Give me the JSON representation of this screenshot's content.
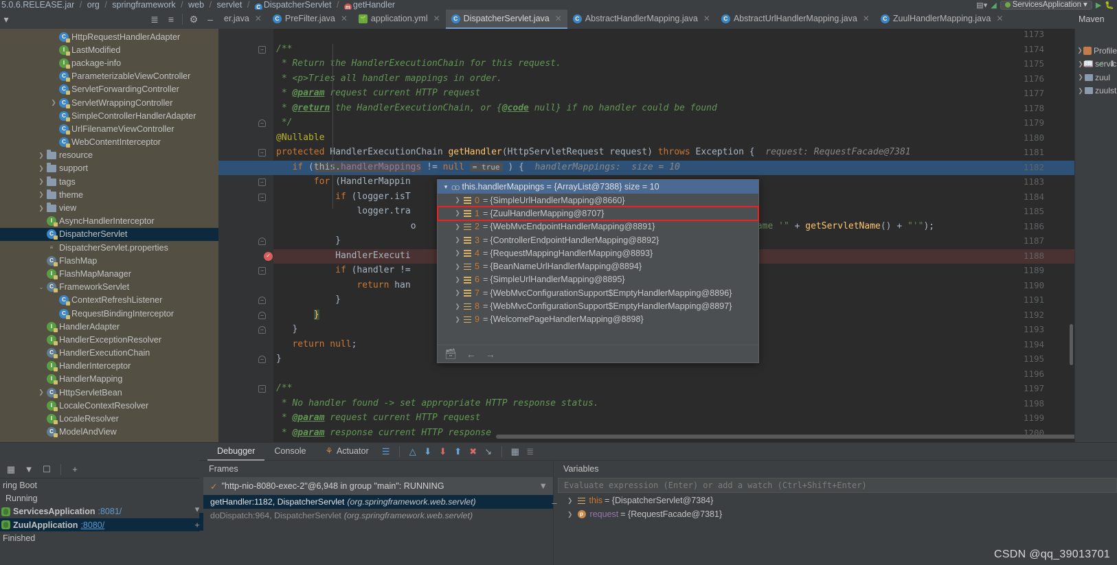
{
  "breadcrumb": {
    "jar": "5.0.6.RELEASE.jar",
    "parts": [
      "org",
      "springframework",
      "web",
      "servlet"
    ],
    "class": "DispatcherServlet",
    "method": "getHandler"
  },
  "run_config": {
    "name": "ServicesApplication"
  },
  "tabs": [
    {
      "label": "er.java",
      "icon": "",
      "active": false,
      "partial": true
    },
    {
      "label": "PreFilter.java",
      "icon": "class-icon",
      "active": false
    },
    {
      "label": "application.yml",
      "icon": "yaml-icon",
      "active": false
    },
    {
      "label": "DispatcherServlet.java",
      "icon": "class-icon",
      "active": true
    },
    {
      "label": "AbstractHandlerMapping.java",
      "icon": "class-icon",
      "active": false
    },
    {
      "label": "AbstractUrlHandlerMapping.java",
      "icon": "class-icon",
      "active": false
    },
    {
      "label": "ZuulHandlerMapping.java",
      "icon": "class-icon",
      "active": false
    }
  ],
  "right_tab": {
    "label": "Maven"
  },
  "tree": [
    {
      "label": "HttpRequestHandlerAdapter",
      "icon": "class-icon",
      "indent": 3,
      "arrow": ""
    },
    {
      "label": "LastModified",
      "icon": "interface-icon",
      "indent": 3,
      "arrow": ""
    },
    {
      "label": "package-info",
      "icon": "interface-icon",
      "indent": 3,
      "arrow": ""
    },
    {
      "label": "ParameterizableViewController",
      "icon": "class-icon",
      "indent": 3,
      "arrow": ""
    },
    {
      "label": "ServletForwardingController",
      "icon": "class-icon",
      "indent": 3,
      "arrow": ""
    },
    {
      "label": "ServletWrappingController",
      "icon": "class-icon",
      "indent": 3,
      "arrow": "collapsed"
    },
    {
      "label": "SimpleControllerHandlerAdapter",
      "icon": "class-icon",
      "indent": 3,
      "arrow": ""
    },
    {
      "label": "UrlFilenameViewController",
      "icon": "class-icon",
      "indent": 3,
      "arrow": ""
    },
    {
      "label": "WebContentInterceptor",
      "icon": "class-icon",
      "indent": 3,
      "arrow": ""
    },
    {
      "label": "resource",
      "icon": "folder-icon",
      "indent": 2,
      "arrow": "collapsed"
    },
    {
      "label": "support",
      "icon": "folder-icon",
      "indent": 2,
      "arrow": "collapsed"
    },
    {
      "label": "tags",
      "icon": "folder-icon",
      "indent": 2,
      "arrow": "collapsed"
    },
    {
      "label": "theme",
      "icon": "folder-icon",
      "indent": 2,
      "arrow": "collapsed"
    },
    {
      "label": "view",
      "icon": "folder-icon",
      "indent": 2,
      "arrow": "collapsed"
    },
    {
      "label": "AsyncHandlerInterceptor",
      "icon": "interface-icon",
      "indent": 2,
      "arrow": ""
    },
    {
      "label": "DispatcherServlet",
      "icon": "class-icon",
      "indent": 2,
      "arrow": "",
      "selected": true
    },
    {
      "label": "DispatcherServlet.properties",
      "icon": "properties-icon",
      "indent": 2,
      "arrow": ""
    },
    {
      "label": "FlashMap",
      "icon": "class-gray-icon",
      "indent": 2,
      "arrow": ""
    },
    {
      "label": "FlashMapManager",
      "icon": "interface-icon",
      "indent": 2,
      "arrow": ""
    },
    {
      "label": "FrameworkServlet",
      "icon": "class-gray-icon",
      "indent": 2,
      "arrow": "expanded"
    },
    {
      "label": "ContextRefreshListener",
      "icon": "class-icon",
      "indent": 3,
      "arrow": ""
    },
    {
      "label": "RequestBindingInterceptor",
      "icon": "class-icon",
      "indent": 3,
      "arrow": ""
    },
    {
      "label": "HandlerAdapter",
      "icon": "interface-icon",
      "indent": 2,
      "arrow": ""
    },
    {
      "label": "HandlerExceptionResolver",
      "icon": "interface-icon",
      "indent": 2,
      "arrow": ""
    },
    {
      "label": "HandlerExecutionChain",
      "icon": "class-gray-icon",
      "indent": 2,
      "arrow": ""
    },
    {
      "label": "HandlerInterceptor",
      "icon": "interface-icon",
      "indent": 2,
      "arrow": ""
    },
    {
      "label": "HandlerMapping",
      "icon": "interface-icon",
      "indent": 2,
      "arrow": ""
    },
    {
      "label": "HttpServletBean",
      "icon": "class-gray-icon",
      "indent": 2,
      "arrow": "collapsed"
    },
    {
      "label": "LocaleContextResolver",
      "icon": "interface-icon",
      "indent": 2,
      "arrow": ""
    },
    {
      "label": "LocaleResolver",
      "icon": "interface-icon",
      "indent": 2,
      "arrow": ""
    },
    {
      "label": "ModelAndView",
      "icon": "class-gray-icon",
      "indent": 2,
      "arrow": ""
    }
  ],
  "editor": {
    "first_line": 1173,
    "lines": [
      {
        "n": 1173,
        "text": ""
      },
      {
        "n": 1174,
        "text": "/**",
        "kind": "comment",
        "fold": "start"
      },
      {
        "n": 1175,
        "text": " * Return the HandlerExecutionChain for this request.",
        "kind": "comment"
      },
      {
        "n": 1176,
        "text": " * <p>Tries all handler mappings in order.",
        "kind": "comment"
      },
      {
        "n": 1177,
        "text": " * @param request current HTTP request",
        "kind": "comment-tag",
        "tag": "@param"
      },
      {
        "n": 1178,
        "text": " * @return the HandlerExecutionChain, or {@code null} if no handler could be found",
        "kind": "comment-tag",
        "tag": "@return"
      },
      {
        "n": 1179,
        "text": " */",
        "kind": "comment",
        "fold": "end"
      },
      {
        "n": 1180,
        "text": "@Nullable",
        "kind": "annotation"
      },
      {
        "n": 1181,
        "text": "protected HandlerExecutionChain getHandler(HttpServletRequest request) throws Exception {",
        "kind": "code",
        "fold": "start",
        "hint": "request: RequestFacade@7381"
      },
      {
        "n": 1182,
        "text": "if (this.handlerMappings != null ) {",
        "kind": "code",
        "highlight": "blue",
        "inline_value": "= true",
        "hint": "handlerMappings:  size = 10"
      },
      {
        "n": 1183,
        "text": "for (HandlerMappin",
        "kind": "code",
        "fold": "start"
      },
      {
        "n": 1184,
        "text": "if (logger.isT",
        "kind": "code",
        "fold": "start"
      },
      {
        "n": 1185,
        "text": "logger.tra",
        "kind": "code"
      },
      {
        "n": 1186,
        "text": "o",
        "kind": "code",
        "tail": "name '\" + getServletName() + \"'\");"
      },
      {
        "n": 1187,
        "text": "}",
        "kind": "code",
        "fold": "end"
      },
      {
        "n": 1188,
        "text": "HandlerExecuti",
        "kind": "code",
        "highlight": "red",
        "breakpoint": true
      },
      {
        "n": 1189,
        "text": "if (handler !=",
        "kind": "code",
        "fold": "start"
      },
      {
        "n": 1190,
        "text": "return han",
        "kind": "code"
      },
      {
        "n": 1191,
        "text": "}",
        "kind": "code",
        "fold": "end"
      },
      {
        "n": 1192,
        "text": "}",
        "kind": "code",
        "fold": "end",
        "caret": true
      },
      {
        "n": 1193,
        "text": "}",
        "kind": "code",
        "fold": "end"
      },
      {
        "n": 1194,
        "text": "return null;",
        "kind": "code"
      },
      {
        "n": 1195,
        "text": "}",
        "kind": "code",
        "fold": "end"
      },
      {
        "n": 1196,
        "text": ""
      },
      {
        "n": 1197,
        "text": "/**",
        "kind": "comment",
        "fold": "start"
      },
      {
        "n": 1198,
        "text": " * No handler found -> set appropriate HTTP response status.",
        "kind": "comment"
      },
      {
        "n": 1199,
        "text": " * @param request current HTTP request",
        "kind": "comment-tag",
        "tag": "@param"
      },
      {
        "n": 1200,
        "text": " * @param response current HTTP response",
        "kind": "comment-tag",
        "tag": "@param"
      }
    ]
  },
  "popup": {
    "header": "this.handlerMappings = {ArrayList@7388}  size = 10",
    "items": [
      {
        "index": "0",
        "value": "{SimpleUrlHandlerMapping@8660}"
      },
      {
        "index": "1",
        "value": "{ZuulHandlerMapping@8707}",
        "marked": true
      },
      {
        "index": "2",
        "value": "{WebMvcEndpointHandlerMapping@8891}"
      },
      {
        "index": "3",
        "value": "{ControllerEndpointHandlerMapping@8892}"
      },
      {
        "index": "4",
        "value": "{RequestMappingHandlerMapping@8893}"
      },
      {
        "index": "5",
        "value": "{BeanNameUrlHandlerMapping@8894}"
      },
      {
        "index": "6",
        "value": "{SimpleUrlHandlerMapping@8895}"
      },
      {
        "index": "7",
        "value": "{WebMvcConfigurationSupport$EmptyHandlerMapping@8896}"
      },
      {
        "index": "8",
        "value": "{WebMvcConfigurationSupport$EmptyHandlerMapping@8897}"
      },
      {
        "index": "9",
        "value": "{WelcomePageHandlerMapping@8898}"
      }
    ]
  },
  "right_sidebar": {
    "items": [
      {
        "label": "Profile",
        "icon": "maven-icon"
      },
      {
        "label": "servic",
        "icon": "folder-icon"
      },
      {
        "label": "zuul",
        "icon": "folder-icon"
      },
      {
        "label": "zuulst",
        "icon": "folder-icon"
      }
    ]
  },
  "run_panel": {
    "header": "ring Boot",
    "status": "Running",
    "apps": [
      {
        "name": "ServicesApplication",
        "port": ":8081/",
        "selected": false
      },
      {
        "name": "ZuulApplication",
        "port": ":8080/",
        "selected": true
      }
    ],
    "footer": "Finished"
  },
  "debugger": {
    "tabs": [
      {
        "label": "Debugger",
        "active": true
      },
      {
        "label": "Console",
        "active": false
      },
      {
        "label": "Actuator",
        "active": false,
        "icon": "actuator-icon"
      }
    ],
    "frames_title": "Frames",
    "thread": "\"http-nio-8080-exec-2\"@6,948 in group \"main\": RUNNING",
    "frames": [
      {
        "text": "getHandler:1182, DispatcherServlet",
        "pkg": "(org.springframework.web.servlet)",
        "selected": true
      },
      {
        "text": "doDispatch:964, DispatcherServlet",
        "pkg": "(org.springframework.web.servlet)",
        "selected": false
      }
    ],
    "variables_title": "Variables",
    "eval_placeholder": "Evaluate expression (Enter) or add a watch (Ctrl+Shift+Enter)",
    "variables": [
      {
        "name": "this",
        "value": "= {DispatcherServlet@7384}",
        "kind": "object"
      },
      {
        "name": "request",
        "value": "= {RequestFacade@7381}",
        "kind": "param"
      }
    ]
  },
  "watermark": "CSDN @qq_39013701",
  "colors": {
    "editor_bg": "#2b2b2b",
    "tree_bg": "#534f43",
    "chrome_bg": "#3c3f41",
    "selection_blue": "#2d5177",
    "mark_red": "#ee2020",
    "accent_blue": "#5b9bd5"
  }
}
